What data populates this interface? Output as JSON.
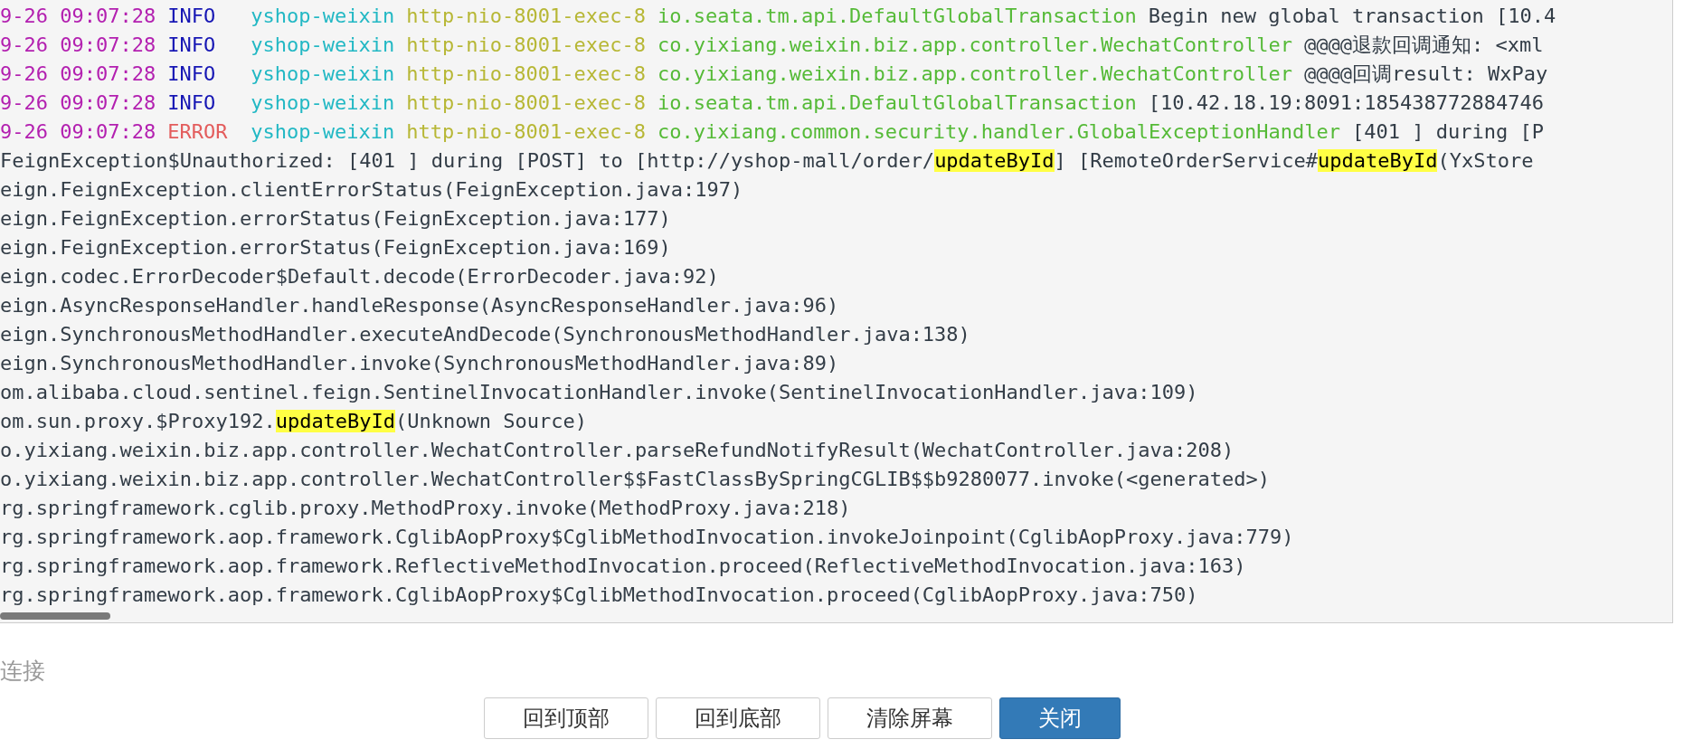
{
  "log": {
    "lines": [
      {
        "kind": "entry",
        "date": "9-26 09:07:28",
        "level": "INFO",
        "app": "yshop-weixin",
        "thread": "http-nio-8001-exec-8",
        "logger": "io.seata.tm.api.DefaultGlobalTransaction",
        "message": "Begin new global transaction [10.4"
      },
      {
        "kind": "entry",
        "date": "9-26 09:07:28",
        "level": "INFO",
        "app": "yshop-weixin",
        "thread": "http-nio-8001-exec-8",
        "logger": "co.yixiang.weixin.biz.app.controller.WechatController",
        "message": "@@@@退款回调通知: <xml"
      },
      {
        "kind": "entry",
        "date": "9-26 09:07:28",
        "level": "INFO",
        "app": "yshop-weixin",
        "thread": "http-nio-8001-exec-8",
        "logger": "co.yixiang.weixin.biz.app.controller.WechatController",
        "message": "@@@@回调result: WxPay"
      },
      {
        "kind": "entry",
        "date": "9-26 09:07:28",
        "level": "INFO",
        "app": "yshop-weixin",
        "thread": "http-nio-8001-exec-8",
        "logger": "io.seata.tm.api.DefaultGlobalTransaction",
        "message": "[10.42.18.19:8091:185438772884746"
      },
      {
        "kind": "entry",
        "date": "9-26 09:07:28",
        "level": "ERROR",
        "app": "yshop-weixin",
        "thread": "http-nio-8001-exec-8",
        "logger": "co.yixiang.common.security.handler.GlobalExceptionHandler",
        "message": "[401 ] during [P"
      },
      {
        "kind": "trace",
        "parts": [
          {
            "text": "FeignException$Unauthorized: [401 ] during [POST] to [http://yshop-mall/order/",
            "highlight": false
          },
          {
            "text": "updateById",
            "highlight": true
          },
          {
            "text": "] [RemoteOrderService#",
            "highlight": false
          },
          {
            "text": "updateById",
            "highlight": true
          },
          {
            "text": "(YxStore",
            "highlight": false
          }
        ]
      },
      {
        "kind": "trace",
        "parts": [
          {
            "text": "eign.FeignException.clientErrorStatus(FeignException.java:197)",
            "highlight": false
          }
        ]
      },
      {
        "kind": "trace",
        "parts": [
          {
            "text": "eign.FeignException.errorStatus(FeignException.java:177)",
            "highlight": false
          }
        ]
      },
      {
        "kind": "trace",
        "parts": [
          {
            "text": "eign.FeignException.errorStatus(FeignException.java:169)",
            "highlight": false
          }
        ]
      },
      {
        "kind": "trace",
        "parts": [
          {
            "text": "eign.codec.ErrorDecoder$Default.decode(ErrorDecoder.java:92)",
            "highlight": false
          }
        ]
      },
      {
        "kind": "trace",
        "parts": [
          {
            "text": "eign.AsyncResponseHandler.handleResponse(AsyncResponseHandler.java:96)",
            "highlight": false
          }
        ]
      },
      {
        "kind": "trace",
        "parts": [
          {
            "text": "eign.SynchronousMethodHandler.executeAndDecode(SynchronousMethodHandler.java:138)",
            "highlight": false
          }
        ]
      },
      {
        "kind": "trace",
        "parts": [
          {
            "text": "eign.SynchronousMethodHandler.invoke(SynchronousMethodHandler.java:89)",
            "highlight": false
          }
        ]
      },
      {
        "kind": "trace",
        "parts": [
          {
            "text": "om.alibaba.cloud.sentinel.feign.SentinelInvocationHandler.invoke(SentinelInvocationHandler.java:109)",
            "highlight": false
          }
        ]
      },
      {
        "kind": "trace",
        "parts": [
          {
            "text": "om.sun.proxy.$Proxy192.",
            "highlight": false
          },
          {
            "text": "updateById",
            "highlight": true
          },
          {
            "text": "(Unknown Source)",
            "highlight": false
          }
        ]
      },
      {
        "kind": "trace",
        "parts": [
          {
            "text": "o.yixiang.weixin.biz.app.controller.WechatController.parseRefundNotifyResult(WechatController.java:208)",
            "highlight": false
          }
        ]
      },
      {
        "kind": "trace",
        "parts": [
          {
            "text": "o.yixiang.weixin.biz.app.controller.WechatController$$FastClassBySpringCGLIB$$b9280077.invoke(<generated>)",
            "highlight": false
          }
        ]
      },
      {
        "kind": "trace",
        "parts": [
          {
            "text": "rg.springframework.cglib.proxy.MethodProxy.invoke(MethodProxy.java:218)",
            "highlight": false
          }
        ]
      },
      {
        "kind": "trace",
        "parts": [
          {
            "text": "rg.springframework.aop.framework.CglibAopProxy$CglibMethodInvocation.invokeJoinpoint(CglibAopProxy.java:779)",
            "highlight": false
          }
        ]
      },
      {
        "kind": "trace",
        "parts": [
          {
            "text": "rg.springframework.aop.framework.ReflectiveMethodInvocation.proceed(ReflectiveMethodInvocation.java:163)",
            "highlight": false
          }
        ]
      },
      {
        "kind": "trace",
        "parts": [
          {
            "text": "rg.springframework.aop.framework.CglibAopProxy$CglibMethodInvocation.proceed(CglibAopProxy.java:750)",
            "highlight": false
          }
        ]
      }
    ]
  },
  "status": "连接",
  "buttons": [
    {
      "label": "回到顶部",
      "kind": "default"
    },
    {
      "label": "回到底部",
      "kind": "default"
    },
    {
      "label": "清除屏幕",
      "kind": "default"
    },
    {
      "label": "关闭",
      "kind": "primary"
    }
  ]
}
